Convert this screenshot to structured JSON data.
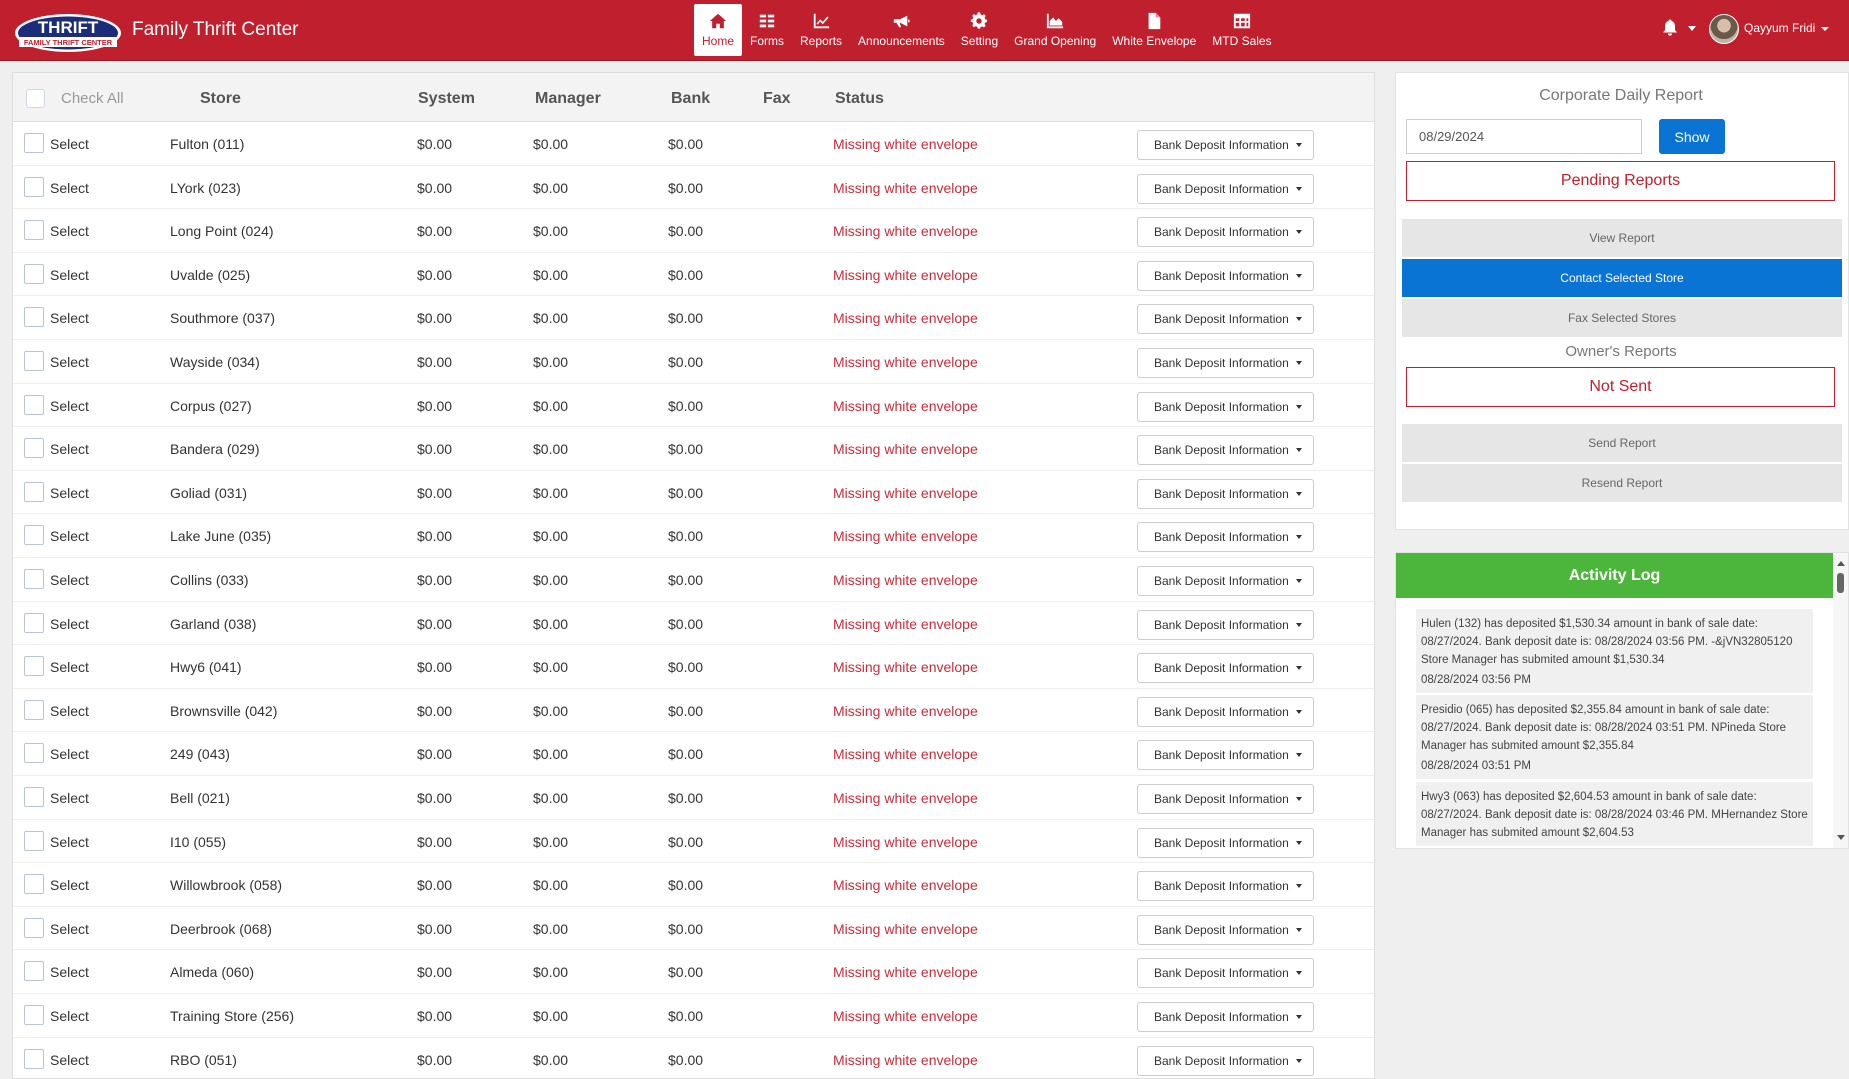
{
  "app": {
    "logo_text": "THRIFT",
    "logo_subtext": "FAMILY THRIFT CENTER",
    "brand": "Family Thrift Center"
  },
  "nav": [
    {
      "label": "Home",
      "icon": "home-icon",
      "active": true
    },
    {
      "label": "Forms",
      "icon": "forms-icon"
    },
    {
      "label": "Reports",
      "icon": "chart-icon"
    },
    {
      "label": "Announcements",
      "icon": "megaphone-icon"
    },
    {
      "label": "Setting",
      "icon": "gear-icon"
    },
    {
      "label": "Grand Opening",
      "icon": "area-chart-icon"
    },
    {
      "label": "White Envelope",
      "icon": "file-icon"
    },
    {
      "label": "MTD Sales",
      "icon": "table-icon"
    }
  ],
  "user": {
    "name": "Qayyum Fridi"
  },
  "table": {
    "check_all": "Check All",
    "headers": {
      "store": "Store",
      "system": "System",
      "manager": "Manager",
      "bank": "Bank",
      "fax": "Fax",
      "status": "Status"
    },
    "select_label": "Select",
    "dropdown_label": "Bank Deposit Information",
    "rows": [
      {
        "store": "Fulton (011)",
        "system": "$0.00",
        "manager": "$0.00",
        "bank": "$0.00",
        "status": "Missing white envelope"
      },
      {
        "store": "LYork (023)",
        "system": "$0.00",
        "manager": "$0.00",
        "bank": "$0.00",
        "status": "Missing white envelope"
      },
      {
        "store": "Long Point (024)",
        "system": "$0.00",
        "manager": "$0.00",
        "bank": "$0.00",
        "status": "Missing white envelope"
      },
      {
        "store": "Uvalde (025)",
        "system": "$0.00",
        "manager": "$0.00",
        "bank": "$0.00",
        "status": "Missing white envelope"
      },
      {
        "store": "Southmore (037)",
        "system": "$0.00",
        "manager": "$0.00",
        "bank": "$0.00",
        "status": "Missing white envelope"
      },
      {
        "store": "Wayside (034)",
        "system": "$0.00",
        "manager": "$0.00",
        "bank": "$0.00",
        "status": "Missing white envelope"
      },
      {
        "store": "Corpus (027)",
        "system": "$0.00",
        "manager": "$0.00",
        "bank": "$0.00",
        "status": "Missing white envelope"
      },
      {
        "store": "Bandera (029)",
        "system": "$0.00",
        "manager": "$0.00",
        "bank": "$0.00",
        "status": "Missing white envelope"
      },
      {
        "store": "Goliad (031)",
        "system": "$0.00",
        "manager": "$0.00",
        "bank": "$0.00",
        "status": "Missing white envelope"
      },
      {
        "store": "Lake June (035)",
        "system": "$0.00",
        "manager": "$0.00",
        "bank": "$0.00",
        "status": "Missing white envelope"
      },
      {
        "store": "Collins (033)",
        "system": "$0.00",
        "manager": "$0.00",
        "bank": "$0.00",
        "status": "Missing white envelope"
      },
      {
        "store": "Garland (038)",
        "system": "$0.00",
        "manager": "$0.00",
        "bank": "$0.00",
        "status": "Missing white envelope"
      },
      {
        "store": "Hwy6 (041)",
        "system": "$0.00",
        "manager": "$0.00",
        "bank": "$0.00",
        "status": "Missing white envelope"
      },
      {
        "store": "Brownsville (042)",
        "system": "$0.00",
        "manager": "$0.00",
        "bank": "$0.00",
        "status": "Missing white envelope"
      },
      {
        "store": "249 (043)",
        "system": "$0.00",
        "manager": "$0.00",
        "bank": "$0.00",
        "status": "Missing white envelope"
      },
      {
        "store": "Bell (021)",
        "system": "$0.00",
        "manager": "$0.00",
        "bank": "$0.00",
        "status": "Missing white envelope"
      },
      {
        "store": "I10 (055)",
        "system": "$0.00",
        "manager": "$0.00",
        "bank": "$0.00",
        "status": "Missing white envelope"
      },
      {
        "store": "Willowbrook (058)",
        "system": "$0.00",
        "manager": "$0.00",
        "bank": "$0.00",
        "status": "Missing white envelope"
      },
      {
        "store": "Deerbrook (068)",
        "system": "$0.00",
        "manager": "$0.00",
        "bank": "$0.00",
        "status": "Missing white envelope"
      },
      {
        "store": "Almeda (060)",
        "system": "$0.00",
        "manager": "$0.00",
        "bank": "$0.00",
        "status": "Missing white envelope"
      },
      {
        "store": "Training Store (256)",
        "system": "$0.00",
        "manager": "$0.00",
        "bank": "$0.00",
        "status": "Missing white envelope"
      },
      {
        "store": "RBO (051)",
        "system": "$0.00",
        "manager": "$0.00",
        "bank": "$0.00",
        "status": "Missing white envelope"
      }
    ]
  },
  "sidebar": {
    "corporate_title": "Corporate Daily Report",
    "date_value": "08/29/2024",
    "show_label": "Show",
    "pending_reports": "Pending Reports",
    "view_report": "View Report",
    "contact_selected": "Contact Selected Store",
    "fax_selected": "Fax Selected Stores",
    "owners_title": "Owner's Reports",
    "not_sent": "Not Sent",
    "send_report": "Send Report",
    "resend_report": "Resend Report"
  },
  "activity_log": {
    "title": "Activity Log",
    "entries": [
      {
        "text": "Hulen (132) has deposited $1,530.34 amount in bank of sale date: 08/27/2024. Bank deposit date is: 08/28/2024 03:56 PM. -&jVN32805120 Store Manager has submited amount $1,530.34",
        "time": "08/28/2024 03:56 PM"
      },
      {
        "text": "Presidio (065) has deposited $2,355.84 amount in bank of sale date: 08/27/2024. Bank deposit date is: 08/28/2024 03:51 PM. NPineda Store Manager has submited amount $2,355.84",
        "time": "08/28/2024 03:51 PM"
      },
      {
        "text": "Hwy3 (063) has deposited $2,604.53 amount in bank of sale date: 08/27/2024. Bank deposit date is: 08/28/2024 03:46 PM. MHernandez Store Manager has submited amount $2,604.53",
        "time": ""
      }
    ]
  },
  "colors": {
    "brand_red": "#c0202e",
    "accent_blue": "#0a74d4",
    "log_green": "#4bb63b",
    "status_red": "#c62d3a"
  }
}
